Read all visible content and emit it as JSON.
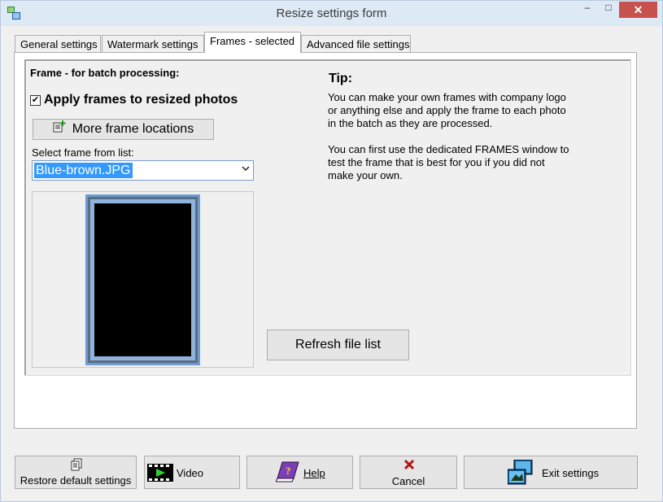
{
  "window": {
    "title": "Resize settings form",
    "minimize_glyph": "–",
    "maximize_glyph": "□",
    "close_glyph": "✕"
  },
  "tabs": [
    {
      "label": "General settings"
    },
    {
      "label": "Watermark settings"
    },
    {
      "label": "Frames - selected"
    },
    {
      "label": "Advanced file settings"
    }
  ],
  "frames": {
    "group_title": "Frame -  for batch processing:",
    "apply_checkbox_label": "Apply frames to resized photos",
    "apply_checked_glyph": "✔",
    "more_locations_button": "More frame locations",
    "select_label": "Select frame from list:",
    "selected_frame": "Blue-brown.JPG",
    "refresh_button": "Refresh file list"
  },
  "tip": {
    "title": "Tip:",
    "para1": [
      "You can make your own frames with company logo",
      "or anything else and apply the frame to each photo",
      "in the batch as they are processed."
    ],
    "para2": [
      "You can first use the dedicated FRAMES window to",
      "test the frame that is best for you if you did not",
      "make your own."
    ]
  },
  "bottom_buttons": {
    "restore": "Restore default settings",
    "video": "Video",
    "help": "Help",
    "cancel": "Cancel",
    "exit": "Exit settings"
  },
  "icons": {
    "app": "app-icon",
    "more": "add-document-icon",
    "restore": "restore-icon",
    "video": "video-clapper-icon",
    "help": "help-book-icon",
    "cancel": "close-x-icon",
    "exit": "exit-icon"
  },
  "colors": {
    "titlebar": "#dee9f6",
    "close_button": "#c7514d",
    "selection": "#3399ff",
    "frame_blue": "#6d9bd1",
    "cancel_red": "#b01515"
  }
}
